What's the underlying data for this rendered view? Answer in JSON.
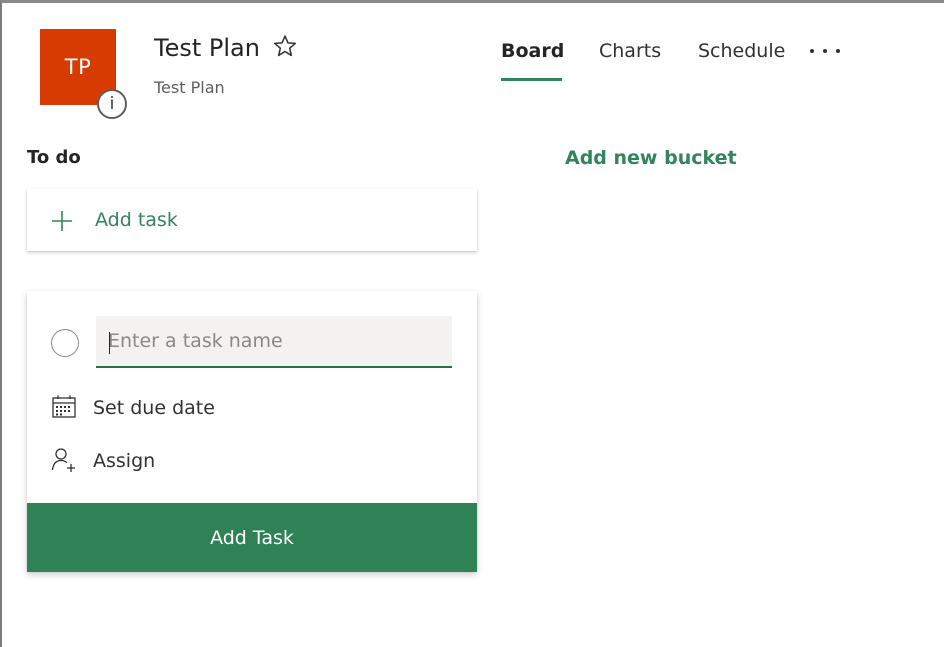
{
  "header": {
    "avatar_initials": "TP",
    "info_badge_text": "i",
    "plan_title": "Test Plan",
    "plan_subtitle": "Test Plan",
    "favorite_icon": "star-outline-icon",
    "tabs": [
      {
        "label": "Board",
        "active": true
      },
      {
        "label": "Charts",
        "active": false
      },
      {
        "label": "Schedule",
        "active": false
      }
    ],
    "more_icon": "ellipsis-icon"
  },
  "board": {
    "bucket_title": "To do",
    "add_bucket_label": "Add new bucket",
    "add_task_label": "Add task",
    "new_task": {
      "name_value": "",
      "name_placeholder": "Enter a task name",
      "due_date_label": "Set due date",
      "assign_label": "Assign",
      "submit_label": "Add Task"
    }
  },
  "colors": {
    "avatar_bg": "#d83b01",
    "accent_green": "#31845b",
    "button_green": "#2e8256",
    "input_underline": "#217346"
  }
}
